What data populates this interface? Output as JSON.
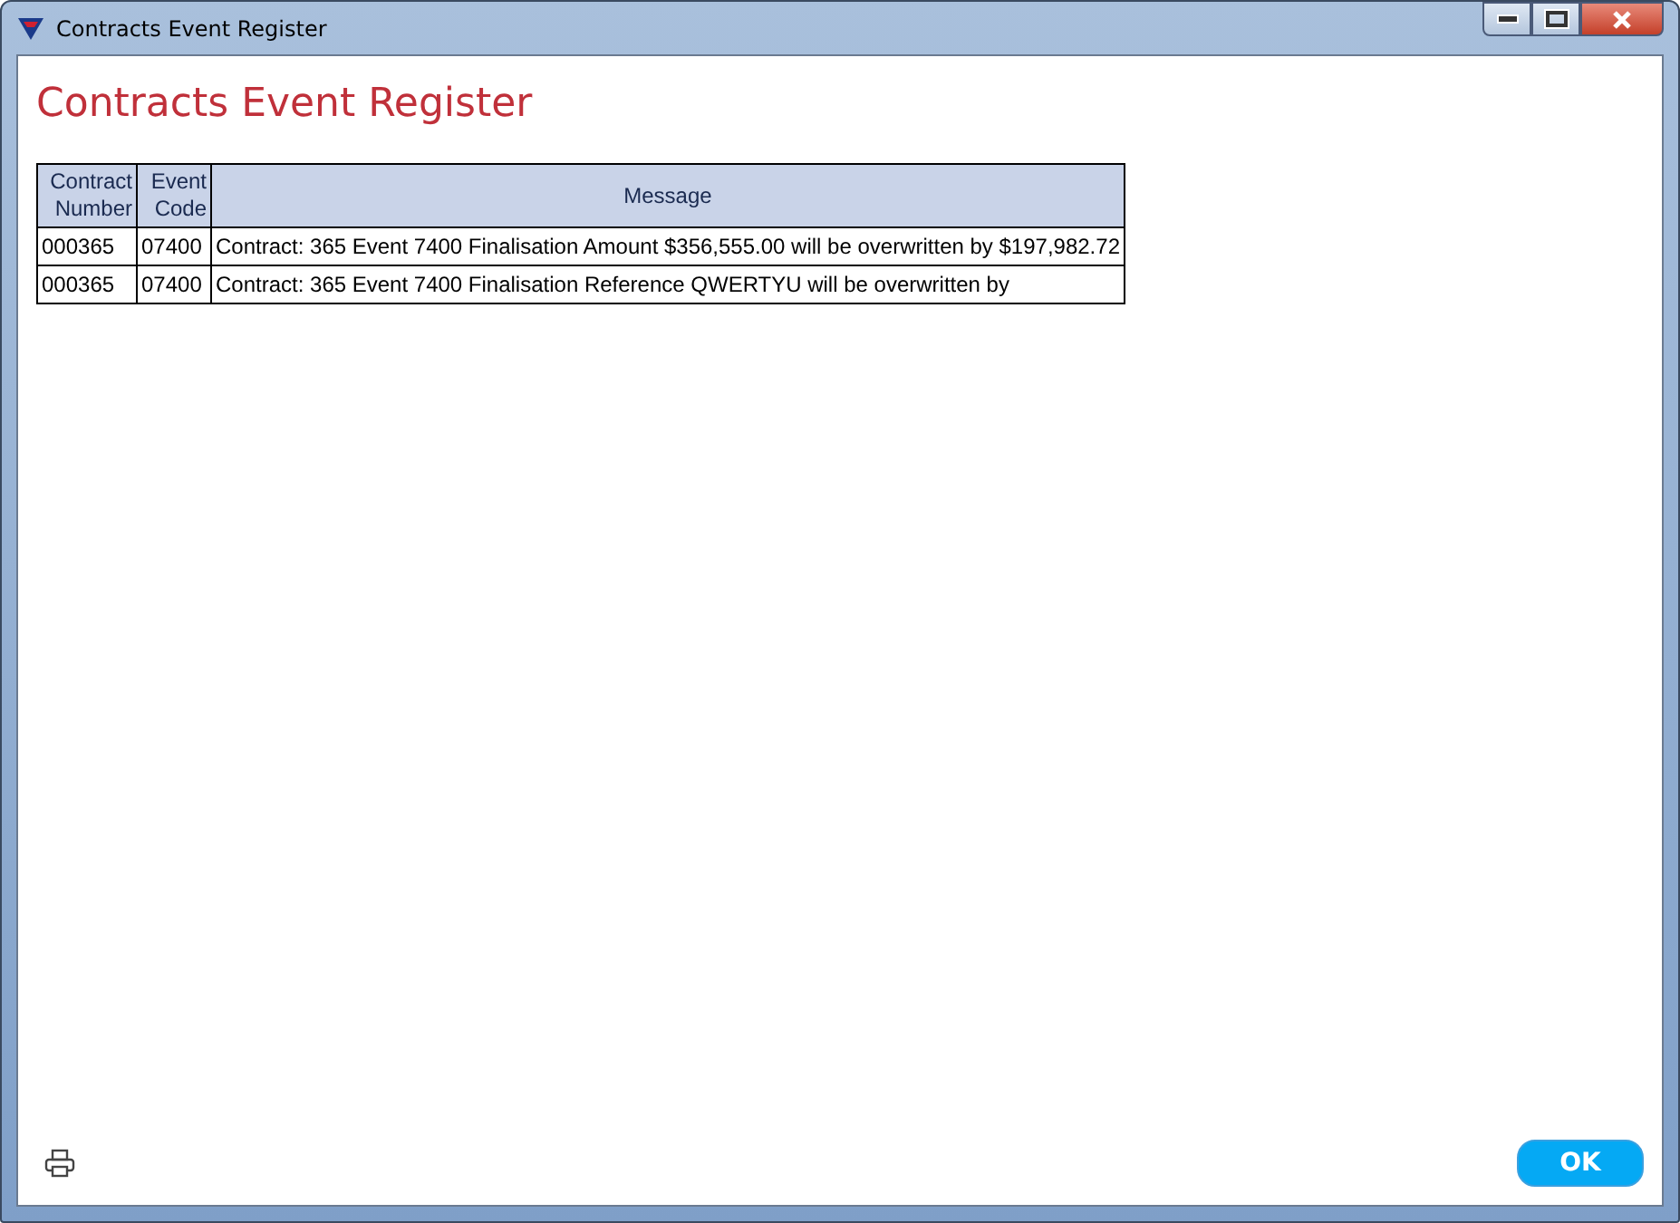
{
  "window": {
    "title": "Contracts Event Register"
  },
  "heading": "Contracts Event Register",
  "table": {
    "columns": [
      "Contract Number",
      "Event Code",
      "Message"
    ],
    "rows": [
      [
        "000365",
        "07400",
        "Contract: 365 Event 7400 Finalisation Amount $356,555.00 will be overwritten by $197,982.72"
      ],
      [
        "000365",
        "07400",
        "Contract: 365 Event 7400 Finalisation Reference QWERTYU will be overwritten by"
      ]
    ]
  },
  "buttons": [
    "OK"
  ]
}
